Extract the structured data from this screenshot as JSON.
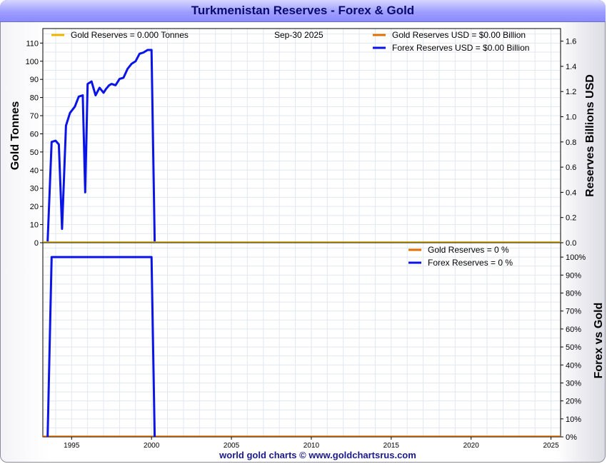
{
  "title": "Turkmenistan Reserves - Forex & Gold",
  "footer": "world gold charts © www.goldchartsrus.com",
  "colors": {
    "gold": "#f0b400",
    "gold_usd": "#e07000",
    "forex": "#0a14e6",
    "grid": "#e2e8f0",
    "zero_line": "#c8a000"
  },
  "chart_data": [
    {
      "type": "line",
      "panel": "top",
      "date_label": "Sep-30  2025",
      "ylabel": "Gold Tonnes",
      "ylabel_right": "Reserves Billions USD",
      "ylim": [
        0,
        118
      ],
      "ylim_right": [
        0,
        1.7
      ],
      "yticks": [
        0,
        10,
        20,
        30,
        40,
        50,
        60,
        70,
        80,
        90,
        100,
        110
      ],
      "yticks_right": [
        "0.0",
        "0.2",
        "0.4",
        "0.6",
        "0.8",
        "1.0",
        "1.2",
        "1.4",
        "1.6"
      ],
      "xlim": [
        1993.2,
        2025.6
      ],
      "xticks": [
        1995,
        2000,
        2005,
        2010,
        2015,
        2020,
        2025
      ],
      "legend": [
        {
          "key": "gold",
          "text": "Gold Reserves  = 0.000 Tonnes"
        },
        {
          "key": "gold_usd",
          "text": "Gold Reserves USD    = $0.00 Billion"
        },
        {
          "key": "forex",
          "text": "Forex Reserves USD  = $0.00 Billion"
        }
      ],
      "series": [
        {
          "key": "forex",
          "axis": "right",
          "x": [
            1993.5,
            1993.75,
            1994.0,
            1994.2,
            1994.4,
            1994.65,
            1994.9,
            1995.2,
            1995.45,
            1995.7,
            1995.85,
            1996.0,
            1996.25,
            1996.5,
            1996.75,
            1997.0,
            1997.15,
            1997.35,
            1997.5,
            1997.75,
            1998.0,
            1998.25,
            1998.5,
            1998.75,
            1999.0,
            1999.25,
            1999.5,
            1999.75,
            2000.0,
            2000.2
          ],
          "y": [
            0.01,
            0.8,
            0.81,
            0.78,
            0.11,
            0.93,
            1.03,
            1.08,
            1.16,
            1.17,
            0.4,
            1.26,
            1.28,
            1.17,
            1.23,
            1.19,
            1.22,
            1.25,
            1.26,
            1.25,
            1.3,
            1.31,
            1.38,
            1.42,
            1.44,
            1.5,
            1.51,
            1.53,
            1.53,
            0.01
          ]
        },
        {
          "key": "gold",
          "axis": "left",
          "x": [
            1993.2,
            2025.6
          ],
          "y": [
            0,
            0
          ]
        }
      ]
    },
    {
      "type": "line",
      "panel": "bottom",
      "ylabel_right": "Forex vs Gold",
      "ylim": [
        0,
        108
      ],
      "yticks": [
        "0%",
        "10%",
        "20%",
        "30%",
        "40%",
        "50%",
        "60%",
        "70%",
        "80%",
        "90%",
        "100%"
      ],
      "xlim": [
        1993.2,
        2025.6
      ],
      "legend": [
        {
          "key": "gold_usd",
          "text": "Gold Reserves      = 0 %"
        },
        {
          "key": "forex",
          "text": "Forex Reserves     = 0 %"
        }
      ],
      "series": [
        {
          "key": "forex",
          "x": [
            1993.5,
            1993.75,
            2000.0,
            2000.2
          ],
          "y": [
            0,
            100,
            100,
            0
          ]
        },
        {
          "key": "gold_usd",
          "x": [
            1993.2,
            2025.6
          ],
          "y": [
            0,
            0
          ]
        }
      ]
    }
  ]
}
